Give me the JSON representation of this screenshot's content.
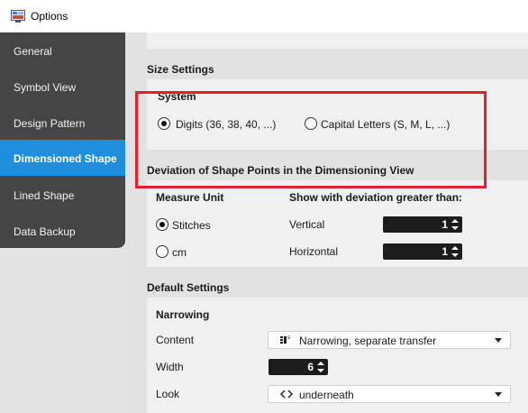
{
  "window": {
    "title": "Options"
  },
  "sidebar": {
    "items": [
      {
        "label": "General",
        "active": false
      },
      {
        "label": "Symbol View",
        "active": false
      },
      {
        "label": "Design Pattern",
        "active": false
      },
      {
        "label": "Dimensioned Shape",
        "active": true
      },
      {
        "label": "Lined Shape",
        "active": false
      },
      {
        "label": "Data Backup",
        "active": false
      }
    ]
  },
  "size_settings": {
    "title": "Size Settings",
    "system_label": "System",
    "options": [
      {
        "label": "Digits (36, 38, 40, ...)",
        "selected": true
      },
      {
        "label": "Capital Letters (S, M, L, ...)",
        "selected": false
      }
    ]
  },
  "deviation": {
    "title": "Deviation of Shape Points in the Dimensioning View",
    "measure_unit_label": "Measure Unit",
    "units": [
      {
        "label": "Stitches",
        "selected": true
      },
      {
        "label": "cm",
        "selected": false
      }
    ],
    "show_label": "Show with deviation greater than:",
    "vertical_label": "Vertical",
    "vertical_value": "1",
    "horizontal_label": "Horizontal",
    "horizontal_value": "1"
  },
  "default_settings": {
    "title": "Default Settings",
    "narrowing_label": "Narrowing",
    "content_label": "Content",
    "content_value": "Narrowing, separate transfer",
    "content_icon": "narrowing-transfer-icon",
    "width_label": "Width",
    "width_value": "6",
    "look_label": "Look",
    "look_value": "underneath",
    "look_icon": "underneath-icon"
  },
  "colors": {
    "accent": "#1f8fdd",
    "sidebar": "#454545",
    "highlight": "#e4202a"
  }
}
